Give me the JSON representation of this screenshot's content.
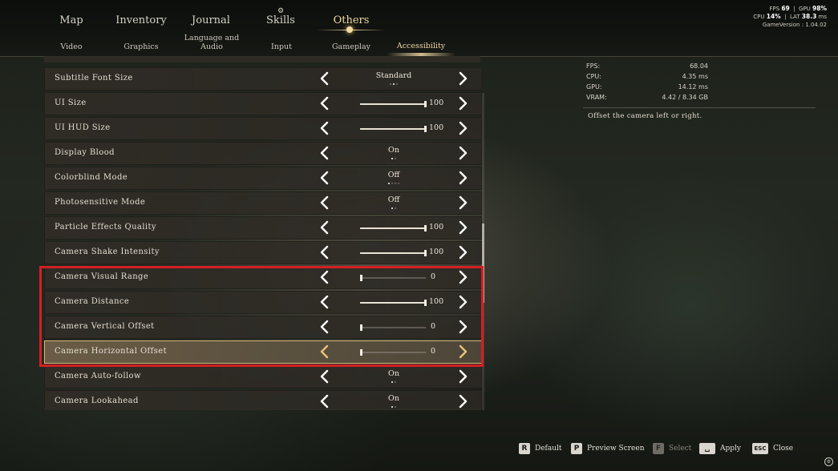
{
  "nav": {
    "main_tabs": [
      {
        "label": "Map",
        "active": false
      },
      {
        "label": "Inventory",
        "active": false
      },
      {
        "label": "Journal",
        "active": false
      },
      {
        "label": "Skills",
        "active": false
      },
      {
        "label": "Others",
        "active": true
      }
    ],
    "sub_tabs": [
      {
        "label": "Video",
        "active": false
      },
      {
        "label": "Graphics",
        "active": false
      },
      {
        "label": "Language and Audio",
        "active": false
      },
      {
        "label": "Input",
        "active": false
      },
      {
        "label": "Gameplay",
        "active": false
      },
      {
        "label": "Accessibility",
        "active": true
      }
    ]
  },
  "hud": {
    "fps_label": "FPS",
    "fps_value": "69",
    "gpu_label": "GPU",
    "gpu_value": "98",
    "cpu_label": "CPU",
    "cpu_value": "14",
    "lat_label": "LAT",
    "lat_value": "38.3",
    "lat_unit": "ms",
    "game_version_label": "GameVersion",
    "game_version_value": "1.04.02"
  },
  "settings": [
    {
      "label": "Subtitle Font Size",
      "kind": "choice",
      "value": "Standard",
      "option_count": 3,
      "selected_index": 1,
      "selected": false
    },
    {
      "label": "UI Size",
      "kind": "slider",
      "value": "100",
      "fraction": 1.0,
      "selected": false
    },
    {
      "label": "UI HUD Size",
      "kind": "slider",
      "value": "100",
      "fraction": 1.0,
      "selected": false
    },
    {
      "label": "Display Blood",
      "kind": "choice",
      "value": "On",
      "option_count": 2,
      "selected_index": 0,
      "selected": false
    },
    {
      "label": "Colorblind Mode",
      "kind": "choice",
      "value": "Off",
      "option_count": 4,
      "selected_index": 0,
      "selected": false
    },
    {
      "label": "Photosensitive Mode",
      "kind": "choice",
      "value": "Off",
      "option_count": 2,
      "selected_index": 0,
      "selected": false
    },
    {
      "label": "Particle Effects Quality",
      "kind": "slider",
      "value": "100",
      "fraction": 1.0,
      "selected": false
    },
    {
      "label": "Camera Shake Intensity",
      "kind": "slider",
      "value": "100",
      "fraction": 1.0,
      "selected": false
    },
    {
      "label": "Camera Visual Range",
      "kind": "slider",
      "value": "0",
      "fraction": 0.0,
      "selected": false
    },
    {
      "label": "Camera Distance",
      "kind": "slider",
      "value": "100",
      "fraction": 1.0,
      "selected": false
    },
    {
      "label": "Camera Vertical Offset",
      "kind": "slider",
      "value": "0",
      "fraction": 0.0,
      "selected": false
    },
    {
      "label": "Camera Horizontal Offset",
      "kind": "slider",
      "value": "0",
      "fraction": 0.0,
      "selected": true
    },
    {
      "label": "Camera Auto-follow",
      "kind": "choice",
      "value": "On",
      "option_count": 2,
      "selected_index": 0,
      "selected": false
    },
    {
      "label": "Camera Lookahead",
      "kind": "choice",
      "value": "On",
      "option_count": 2,
      "selected_index": 0,
      "selected": false
    }
  ],
  "scroll": {
    "position": 0.55,
    "visible_fraction": 0.25
  },
  "performance": {
    "rows": [
      {
        "label": "FPS:",
        "value": "68.04"
      },
      {
        "label": "CPU:",
        "value": "4.35 ms"
      },
      {
        "label": "GPU:",
        "value": "14.12 ms"
      },
      {
        "label": "VRAM:",
        "value": "4.42 / 8.34 GB"
      }
    ]
  },
  "description": "Offset the camera left or right.",
  "footer": {
    "default": {
      "key": "R",
      "label": "Default"
    },
    "preview": {
      "key": "P",
      "label": "Preview Screen"
    },
    "select": {
      "key": "F",
      "label": "Select"
    },
    "apply": {
      "key": "␣",
      "label": "Apply"
    },
    "close": {
      "key": "ESC",
      "label": "Close"
    }
  },
  "colors": {
    "accent_gold": "#f0d7a4",
    "highlight_red": "#d41f23",
    "selected_border": "#d7b777"
  }
}
